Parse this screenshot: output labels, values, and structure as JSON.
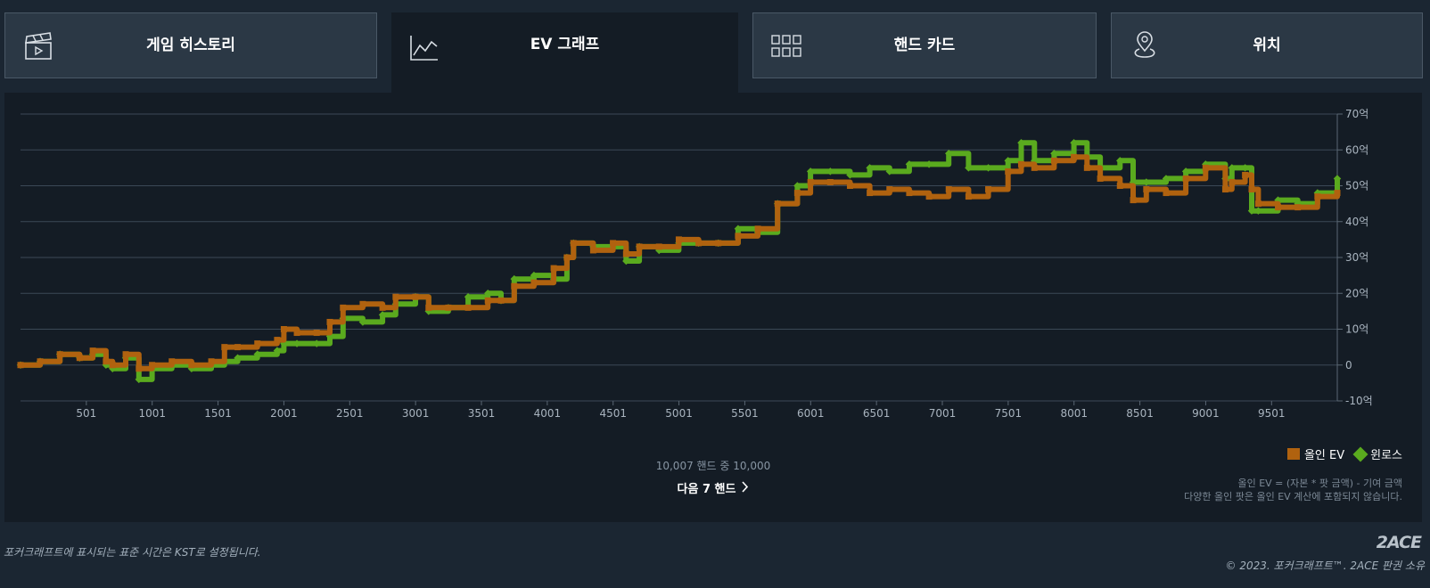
{
  "tabs": [
    {
      "label": "게임 히스토리",
      "icon": "clapperboard-icon",
      "active": false
    },
    {
      "label": "EV 그래프",
      "icon": "line-chart-icon",
      "active": true
    },
    {
      "label": "핸드 카드",
      "icon": "grid-icon",
      "active": false
    },
    {
      "label": "위치",
      "icon": "location-pin-icon",
      "active": false
    }
  ],
  "colors": {
    "allin_ev": "#b0620f",
    "winloss": "#5aaa1e",
    "panel_bg": "#141c25",
    "page_bg": "#1b2632"
  },
  "chart_data": {
    "type": "line",
    "title": "",
    "xlabel": "",
    "ylabel": "",
    "xlim": [
      1,
      10000
    ],
    "ylim": [
      -10,
      70
    ],
    "grid": true,
    "legend_position": "bottom-right",
    "y_axis_side": "right",
    "x_ticks": [
      "501",
      "1001",
      "1501",
      "2001",
      "2501",
      "3001",
      "3501",
      "4001",
      "4501",
      "5001",
      "5501",
      "6001",
      "6501",
      "7001",
      "7501",
      "8001",
      "8501",
      "9001",
      "9501"
    ],
    "y_ticks": [
      "-10억",
      "0",
      "10억",
      "20억",
      "30억",
      "40억",
      "50억",
      "60억",
      "70억"
    ],
    "series": [
      {
        "name": "올인 EV",
        "marker": "square",
        "x": [
          1,
          150,
          300,
          450,
          550,
          650,
          700,
          800,
          900,
          1000,
          1150,
          1300,
          1450,
          1550,
          1650,
          1800,
          1950,
          2001,
          2100,
          2250,
          2350,
          2450,
          2600,
          2750,
          2850,
          3000,
          3100,
          3250,
          3400,
          3550,
          3650,
          3750,
          3900,
          4050,
          4150,
          4200,
          4350,
          4500,
          4600,
          4700,
          4850,
          5000,
          5150,
          5300,
          5450,
          5600,
          5750,
          5900,
          6000,
          6150,
          6300,
          6450,
          6600,
          6750,
          6900,
          7050,
          7200,
          7350,
          7500,
          7600,
          7700,
          7850,
          8000,
          8100,
          8200,
          8350,
          8450,
          8550,
          8700,
          8850,
          9000,
          9150,
          9200,
          9300,
          9350,
          9400,
          9550,
          9700,
          9850,
          10000
        ],
        "y": [
          0,
          1,
          3,
          2,
          4,
          1,
          0,
          3,
          -1,
          0,
          1,
          0,
          1,
          5,
          5,
          6,
          7,
          10,
          9,
          9,
          12,
          16,
          17,
          16,
          19,
          19,
          16,
          16,
          16,
          18,
          18,
          22,
          23,
          27,
          30,
          34,
          32,
          34,
          31,
          33,
          33,
          35,
          34,
          34,
          36,
          38,
          45,
          48,
          51,
          51,
          50,
          48,
          49,
          48,
          47,
          49,
          47,
          49,
          54,
          56,
          55,
          57,
          58,
          55,
          52,
          50,
          46,
          49,
          48,
          52,
          55,
          49,
          51,
          53,
          49,
          45,
          44,
          44,
          47,
          48
        ]
      },
      {
        "name": "윈로스",
        "marker": "diamond",
        "x": [
          1,
          150,
          300,
          450,
          550,
          650,
          700,
          800,
          900,
          1000,
          1150,
          1300,
          1450,
          1550,
          1650,
          1800,
          1950,
          2001,
          2100,
          2250,
          2350,
          2450,
          2600,
          2750,
          2850,
          3000,
          3100,
          3250,
          3400,
          3550,
          3650,
          3750,
          3900,
          4050,
          4150,
          4200,
          4350,
          4500,
          4600,
          4700,
          4850,
          5000,
          5150,
          5300,
          5450,
          5600,
          5750,
          5900,
          6000,
          6150,
          6300,
          6450,
          6600,
          6750,
          6900,
          7050,
          7200,
          7350,
          7500,
          7600,
          7700,
          7850,
          8000,
          8100,
          8200,
          8350,
          8450,
          8550,
          8700,
          8850,
          9000,
          9150,
          9200,
          9300,
          9350,
          9400,
          9550,
          9700,
          9850,
          10000
        ],
        "y": [
          0,
          1,
          3,
          2,
          3,
          0,
          -1,
          2,
          -4,
          -1,
          0,
          -1,
          0,
          1,
          2,
          3,
          4,
          6,
          6,
          6,
          8,
          13,
          12,
          14,
          17,
          19,
          15,
          16,
          19,
          20,
          18,
          24,
          25,
          24,
          30,
          34,
          33,
          33,
          29,
          33,
          32,
          34,
          34,
          34,
          38,
          37,
          45,
          50,
          54,
          54,
          53,
          55,
          54,
          56,
          56,
          59,
          55,
          55,
          57,
          62,
          57,
          59,
          62,
          58,
          55,
          57,
          51,
          51,
          52,
          54,
          56,
          52,
          55,
          55,
          43,
          43,
          46,
          45,
          48,
          52
        ]
      }
    ]
  },
  "footer_info": {
    "hand_count": "10,007 핸드 중 10,000",
    "next_label": "다음 7 핸드",
    "note_line1": "올인 EV = (자본 * 팟 금액) - 기여 금액",
    "note_line2": "다양한 올인 팟은 올인 EV 계산에 포함되지 않습니다."
  },
  "page_footer": {
    "timezone_note": "포커크래프트에 표시되는 표준 시간은 KST로 설정됩니다.",
    "logo": "2ACE",
    "copyright": "© 2023. 포커크래프트™. 2ACE 판권 소유"
  }
}
